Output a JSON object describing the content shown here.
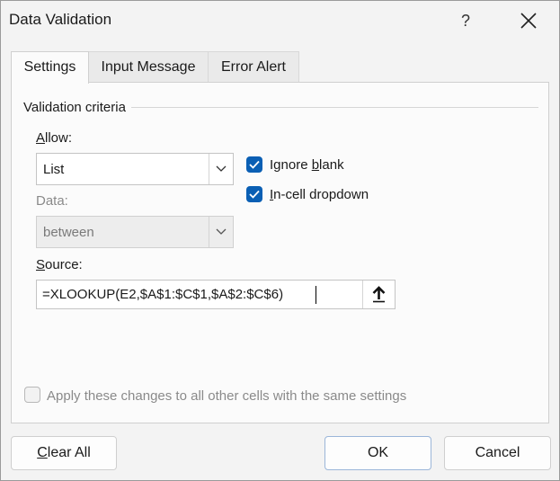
{
  "window": {
    "title": "Data Validation",
    "help": "?"
  },
  "tabs": [
    {
      "label": "Settings",
      "active": true
    },
    {
      "label": "Input Message",
      "active": false
    },
    {
      "label": "Error Alert",
      "active": false
    }
  ],
  "criteria": {
    "group_label": "Validation criteria",
    "allow": {
      "label_key": "A",
      "label_rest": "llow:",
      "value": "List"
    },
    "data": {
      "label": "Data:",
      "value": "between"
    },
    "ignore_blank": {
      "label_pre": "Ignore ",
      "label_key": "b",
      "label_post": "lank",
      "checked": true
    },
    "in_cell_dropdown": {
      "label_key": "I",
      "label_rest": "n-cell dropdown",
      "checked": true
    },
    "source": {
      "label_key": "S",
      "label_rest": "ource:",
      "value": "=XLOOKUP(E2,$A$1:$C$1,$A$2:$C$6)"
    }
  },
  "apply_all": {
    "label": "Apply these changes to all other cells with the same settings",
    "checked": false,
    "enabled": false
  },
  "buttons": {
    "clear_all_key": "C",
    "clear_all_rest": "lear All",
    "ok": "OK",
    "cancel": "Cancel"
  },
  "colors": {
    "accent": "#0a5fb4"
  }
}
